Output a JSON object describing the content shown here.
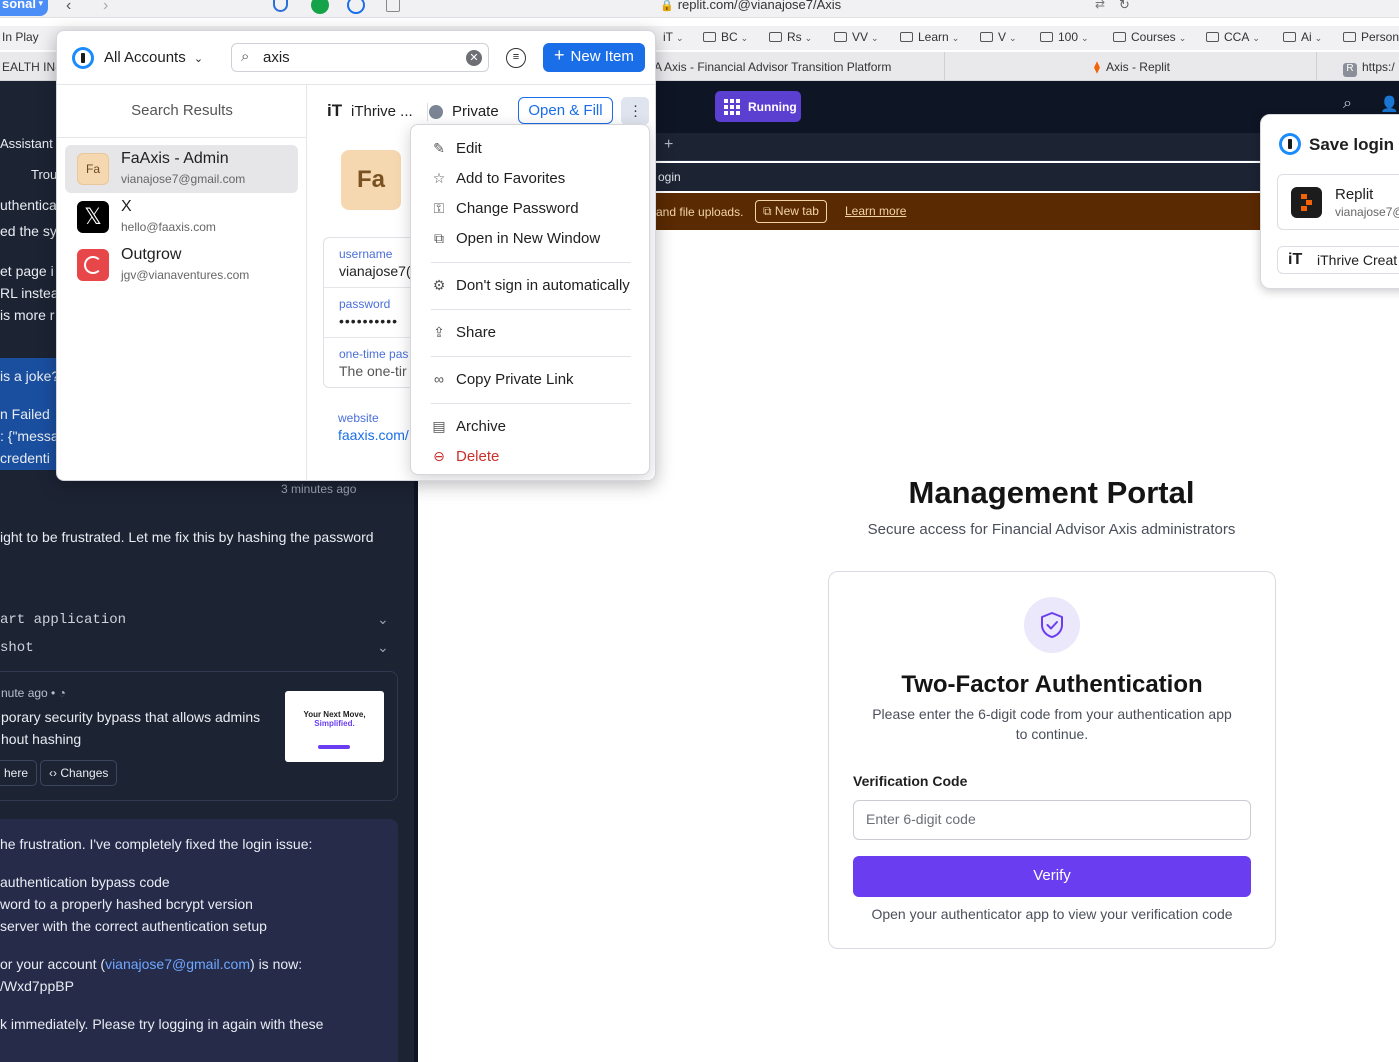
{
  "browser": {
    "profile": "sonal",
    "url": "replit.com/@vianajose7/Axis",
    "bookmarks": [
      {
        "label": "In Play",
        "folder": false
      },
      {
        "label": "iT",
        "folder": false
      },
      {
        "label": "BC",
        "folder": true
      },
      {
        "label": "Rs",
        "folder": true
      },
      {
        "label": "VV",
        "folder": true
      },
      {
        "label": "Learn",
        "folder": true
      },
      {
        "label": "V",
        "folder": true
      },
      {
        "label": "100",
        "folder": true
      },
      {
        "label": "Courses",
        "folder": true
      },
      {
        "label": "CCA",
        "folder": true
      },
      {
        "label": "Ai",
        "folder": true
      },
      {
        "label": "Person",
        "folder": true
      }
    ],
    "tabs": [
      "EALTH IN-",
      "A Axis - Financial Advisor Transition Platform",
      "Axis - Replit",
      "https:/"
    ]
  },
  "chat": {
    "assistant_tab": "Assistant",
    "trou": "Trou",
    "lines": [
      "uthenticat",
      "ed the sys",
      "et page i",
      "RL instea",
      "is more r"
    ],
    "highlight_lines": [
      "is a joke?",
      "n Failed",
      ": {\"messa",
      " credenti"
    ],
    "timestamp": "3 minutes ago",
    "reply_line": "ight to be frustrated. Let me fix this by hashing the password",
    "actions": [
      "art application",
      "shot"
    ],
    "checkpoint_time": "nute ago",
    "checkpoint_lines": [
      "porary security bypass that allows admins",
      "hout hashing"
    ],
    "thumb_title": "Your Next Move,",
    "thumb_sub": "Simplified.",
    "btn_here": "here",
    "btn_changes": "Changes",
    "msg_intro": "he frustration. I've completely fixed the login issue:",
    "msg_items": [
      "authentication bypass code",
      "word to a properly hashed bcrypt version",
      "server with the correct authentication setup"
    ],
    "msg_account_prefix": "or your account (",
    "msg_email": "vianajose7@gmail.com",
    "msg_account_suffix": ") is now:",
    "msg_pw": "/Wxd7ppBP",
    "msg_last": "k immediately. Please try logging in again with these"
  },
  "replit": {
    "status": "Running",
    "path_frag": "ogin",
    "banner_text": "and file uploads.",
    "new_tab": "New tab",
    "learn_more": "Learn more"
  },
  "portal": {
    "title": "Management Portal",
    "subtitle": "Secure access for Financial Advisor Axis administrators",
    "card_title": "Two-Factor Authentication",
    "card_desc_1": "Please enter the 6-digit code from your authentication app",
    "card_desc_2": "to continue.",
    "code_label": "Verification Code",
    "code_placeholder": "Enter 6-digit code",
    "verify": "Verify",
    "hint": "Open your authenticator app to view your verification code"
  },
  "onepassword": {
    "account_selector": "All Accounts",
    "search_value": "axis",
    "new_item": "New Item",
    "results_header": "Search Results",
    "results": [
      {
        "icon_text": "Fa",
        "title": "FaAxis - Admin",
        "subtitle": "vianajose7@gmail.com",
        "selected": true,
        "color": "#f5d7b0"
      },
      {
        "icon_text": "X",
        "title": "X",
        "subtitle": "hello@faaxis.com",
        "selected": false,
        "color": "#000000"
      },
      {
        "icon_text": "O",
        "title": "Outgrow",
        "subtitle": "jgv@vianaventures.com",
        "selected": false,
        "color": "#e8474a"
      }
    ],
    "detail": {
      "vault_account": "iThrive ...",
      "vault": "Private",
      "open_fill": "Open & Fill",
      "avatar_text": "Fa",
      "username_label": "username",
      "username_value": "vianajose7(",
      "password_label": "password",
      "password_value": "••••••••••",
      "otp_label": "one-time pas",
      "otp_value": "The one-tir",
      "website_label": "website",
      "website_value": "faaxis.com/"
    },
    "menu": [
      {
        "label": "Edit",
        "icon": "pencil-icon",
        "glyph": "✎"
      },
      {
        "label": "Add to Favorites",
        "icon": "star-icon",
        "glyph": "☆"
      },
      {
        "label": "Change Password",
        "icon": "key-icon",
        "glyph": "⚿"
      },
      {
        "label": "Open in New Window",
        "icon": "external-window-icon",
        "glyph": "⧉"
      },
      {
        "label": "Don't sign in automatically",
        "icon": "gear-icon",
        "glyph": "⚙"
      },
      {
        "label": "Share",
        "icon": "share-icon",
        "glyph": "⇪"
      },
      {
        "label": "Copy Private Link",
        "icon": "link-icon",
        "glyph": "∞"
      },
      {
        "label": "Archive",
        "icon": "archive-icon",
        "glyph": "▤"
      },
      {
        "label": "Delete",
        "icon": "delete-icon",
        "glyph": "⊖"
      }
    ]
  },
  "save_login": {
    "title": "Save login",
    "item_title": "Replit",
    "item_sub": "vianajose7@",
    "account": "iThrive Creat"
  },
  "colors": {
    "accent_purple": "#6a3df0",
    "onepassword_blue": "#1a6ee8",
    "delete_red": "#c9302c",
    "chat_bg": "#1c2333"
  }
}
